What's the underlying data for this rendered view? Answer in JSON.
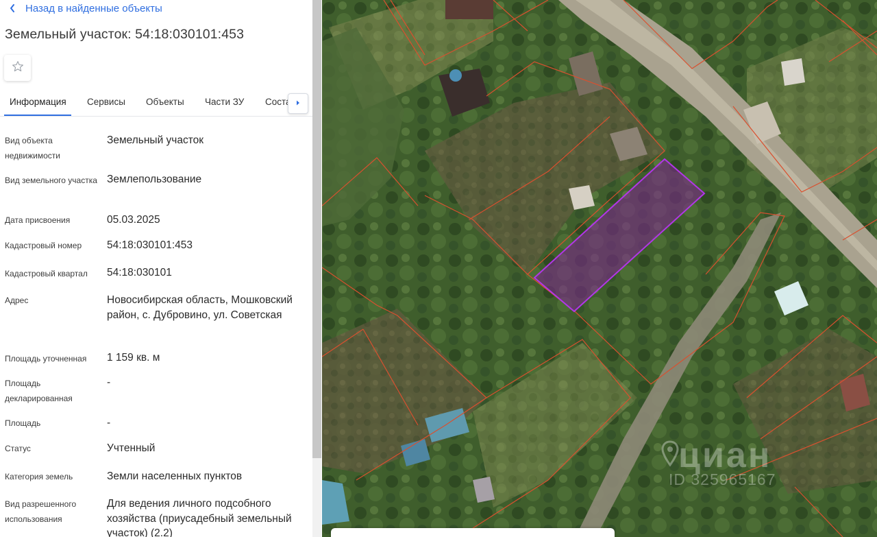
{
  "header": {
    "back_label": "Назад в найденные объекты",
    "title": "Земельный участок: 54:18:030101:453"
  },
  "tabs": [
    {
      "label": "Информация",
      "active": true
    },
    {
      "label": "Сервисы",
      "active": false
    },
    {
      "label": "Объекты",
      "active": false
    },
    {
      "label": "Части ЗУ",
      "active": false
    },
    {
      "label": "Соста",
      "active": false
    }
  ],
  "details": [
    {
      "label": "Вид объекта недвижимости",
      "value": "Земельный участок"
    },
    {
      "label": "Вид земельного участка",
      "value": "Землепользование"
    },
    {
      "label": "Дата присвоения",
      "value": "05.03.2025"
    },
    {
      "label": "Кадастровый номер",
      "value": "54:18:030101:453"
    },
    {
      "label": "Кадастровый квартал",
      "value": "54:18:030101"
    },
    {
      "label": "Адрес",
      "value": "Новосибирская область, Мошковский район, с. Дубровино, ул. Советская"
    },
    {
      "label": "Площадь уточненная",
      "value": "1 159 кв. м"
    },
    {
      "label": "Площадь декларированная",
      "value": "-"
    },
    {
      "label": "Площадь",
      "value": "-"
    },
    {
      "label": "Статус",
      "value": "Учтенный"
    },
    {
      "label": "Категория земель",
      "value": "Земли населенных пунктов"
    },
    {
      "label": "Вид разрешенного использования",
      "value": "Для ведения личного подсобного хозяйства (приусадебный земельный участок) (2.2)"
    }
  ],
  "map": {
    "watermark_brand": "циан",
    "watermark_id": "ID 325965167"
  },
  "icons": {
    "back": "chevron-left-icon",
    "favorite": "star-outline-icon",
    "tabs_next": "caret-right-icon"
  },
  "colors": {
    "accent": "#2f6ee0",
    "parcel_highlight": "#b236e8",
    "cadastral_lines": "#d9502f"
  }
}
